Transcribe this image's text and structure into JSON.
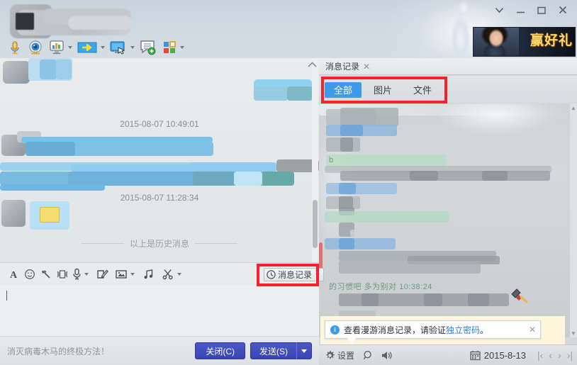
{
  "window": {
    "title": "",
    "controls": {
      "dropdown": "▾",
      "minimize": "—",
      "maximize": "□",
      "close": "✕"
    }
  },
  "ad": {
    "text": "赢好礼"
  },
  "top_toolbar": {
    "items": [
      {
        "name": "voice-call-icon",
        "label": "",
        "has_caret": false
      },
      {
        "name": "video-call-icon",
        "label": "",
        "has_caret": false
      },
      {
        "name": "app-panel-icon",
        "label": "",
        "has_caret": true
      },
      {
        "name": "file-transfer-icon",
        "label": "",
        "has_caret": true
      },
      {
        "name": "remote-desktop-icon",
        "label": "",
        "has_caret": true
      },
      {
        "name": "create-discussion-icon",
        "label": "",
        "has_caret": false
      },
      {
        "name": "apps-grid-icon",
        "label": "",
        "has_caret": true
      }
    ],
    "collapse_glyph": "⌃"
  },
  "chat": {
    "timestamps": [
      "2015-08-07 10:49:01",
      "2015-08-07 11:28:34"
    ],
    "history_divider": "以上是历史消息"
  },
  "input_toolbar": {
    "items": [
      {
        "name": "font-style-icon",
        "glyph": "A",
        "has_caret": false
      },
      {
        "name": "emoji-icon",
        "glyph": "☺",
        "has_caret": false
      },
      {
        "name": "magic-emoji-icon",
        "glyph": "✷",
        "has_caret": false
      },
      {
        "name": "shake-window-icon",
        "glyph": "▓",
        "has_caret": false
      },
      {
        "name": "voice-message-icon",
        "glyph": "🎤",
        "has_caret": true
      },
      {
        "name": "screenshot-icon",
        "glyph": "✎",
        "has_caret": false
      },
      {
        "name": "send-image-icon",
        "glyph": "▣",
        "has_caret": true
      },
      {
        "name": "music-share-icon",
        "glyph": "♫",
        "has_caret": false
      },
      {
        "name": "cut-icon",
        "glyph": "✂",
        "has_caret": true
      }
    ],
    "message_log_button": {
      "label": "消息记录",
      "icon": "clock-icon",
      "caret": "▾"
    }
  },
  "footer": {
    "promo_text": "消灭病毒木马的终极方法！",
    "close_button": "关闭(C)",
    "send_button": "发送(S)",
    "send_caret": "▾"
  },
  "log_panel": {
    "tab_title": "消息记录",
    "tab_close": "✕",
    "filters": [
      {
        "label": "全部",
        "active": true
      },
      {
        "label": "图片",
        "active": false
      },
      {
        "label": "文件",
        "active": false
      }
    ],
    "content_fragments": {
      "green_line": "的习惯吧   多为别对  10:38:24",
      "green_small": "b"
    },
    "scrollbar": {
      "up": "▲",
      "down": "▼"
    }
  },
  "tooltip": {
    "text_before": "查看漫游消息记录，请验证",
    "link": "独立密码",
    "text_after": "。",
    "info_glyph": "i",
    "close_glyph": "✕"
  },
  "log_footer": {
    "settings_label": "设置",
    "settings_icon": "gear-icon",
    "search_icon": "search-icon",
    "sound_icon": "speaker-icon",
    "calendar_icon": "calendar-icon",
    "date": "2015-8-13",
    "nav": {
      "first": "|‹",
      "prev": "‹",
      "next": "›",
      "last": "›|"
    }
  },
  "colors": {
    "accent_blue": "#3d9ae8",
    "annotation_red": "#f5222d",
    "send_button": "#3a45b5",
    "link": "#2f7fd0"
  }
}
